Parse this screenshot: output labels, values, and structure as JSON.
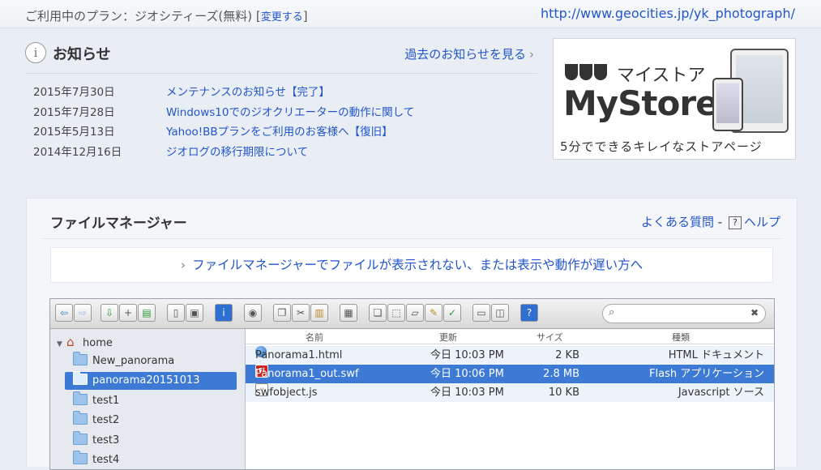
{
  "plan": {
    "label": "ご利用中のプラン：ジオシティーズ(無料)",
    "change_link": "変更する",
    "site_url": "http://www.geocities.jp/yk_photograph/"
  },
  "news": {
    "title": "お知らせ",
    "past_link": "過去のお知らせを見る",
    "items": [
      {
        "date": "2015年7月30日",
        "title": "メンテナンスのお知らせ【完了】"
      },
      {
        "date": "2015年7月28日",
        "title": "Windows10でのジオクリエーターの動作に関して"
      },
      {
        "date": "2015年5月13日",
        "title": "Yahoo!BBプランをご利用のお客様へ【復旧】"
      },
      {
        "date": "2014年12月16日",
        "title": "ジオログの移行期限について"
      }
    ]
  },
  "banner": {
    "kana": "マイストア",
    "logo": "MyStore",
    "tagline": "5分でできるキレイなストアページ"
  },
  "file_manager": {
    "title": "ファイルマネージャー",
    "faq_link": "よくある質問",
    "separator": "-",
    "help_link": "ヘルプ",
    "notice": "ファイルマネージャーでファイルが表示されない、または表示や動作が遅い方へ",
    "search": {
      "placeholder": "",
      "value": ""
    },
    "tree": {
      "root": "home",
      "folders": [
        "New_panorama",
        "panorama20151013",
        "test1",
        "test2",
        "test3",
        "test4"
      ],
      "selected": "panorama20151013"
    },
    "columns": {
      "name": "名前",
      "modified": "更新",
      "size": "サイズ",
      "kind": "種類"
    },
    "files": [
      {
        "name": "Panorama1.html",
        "modified": "今日 10:03 PM",
        "size": "2 KB",
        "kind": "HTML ドキュメント",
        "icon": "html-icon"
      },
      {
        "name": "Panorama1_out.swf",
        "modified": "今日 10:06 PM",
        "size": "2.8 MB",
        "kind": "Flash アプリケーション",
        "icon": "swf-icon"
      },
      {
        "name": "swfobject.js",
        "modified": "今日 10:03 PM",
        "size": "10 KB",
        "kind": "Javascript ソース",
        "icon": "js-icon"
      }
    ],
    "toolbar": [
      "back-icon",
      "forward-icon",
      "upload-icon",
      "new-file-icon",
      "save-icon",
      "copy-icon",
      "paste-icon",
      "info-icon",
      "view-icon",
      "duplicate-icon",
      "cut-icon",
      "clipboard-icon",
      "archive-icon",
      "pages-icon",
      "select-icon",
      "rename-icon",
      "edit-icon",
      "checklist-icon",
      "grid-view-icon",
      "columns-view-icon",
      "help-icon"
    ]
  }
}
